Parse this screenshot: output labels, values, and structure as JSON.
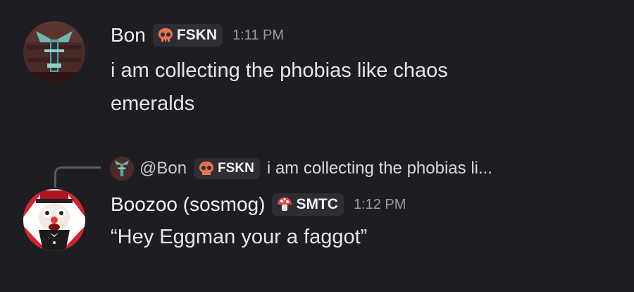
{
  "messages": [
    {
      "author": "Bon",
      "tag": {
        "icon": "skull-icon",
        "label": "FSKN"
      },
      "timestamp": "1:11 PM",
      "lines": [
        "i am collecting the phobias like chaos",
        "emeralds"
      ]
    },
    {
      "author": "Boozoo (sosmog)",
      "tag": {
        "icon": "mushroom-icon",
        "label": "SMTC"
      },
      "timestamp": "1:12 PM",
      "lines": [
        "“Hey Eggman your a faggot”"
      ],
      "reply": {
        "author": "@Bon",
        "tag": {
          "icon": "skull-icon",
          "label": "FSKN"
        },
        "text": "i am collecting the phobias li..."
      }
    }
  ],
  "colors": {
    "background": "#1e1e22",
    "tag_background": "#2d2d33",
    "skull": "#e8734e",
    "mushroom": "#e04a4a"
  }
}
